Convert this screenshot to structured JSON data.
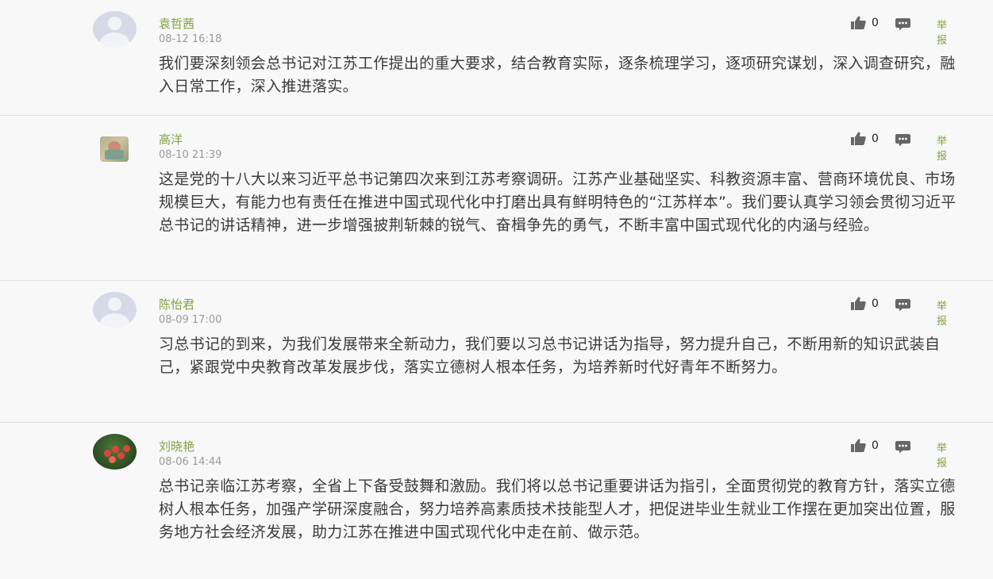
{
  "comments": [
    {
      "name": "袁哲茜",
      "time": "08-12 16:18",
      "text": "我们要深刻领会总书记对江苏工作提出的重大要求，结合教育实际，逐条梳理学习，逐项研究谋划，深入调查研究，融入日常工作，深入推进落实。",
      "likes": "0",
      "report": "举报",
      "avatar": "default-avatar"
    },
    {
      "name": "高洋",
      "time": "08-10 21:39",
      "text": "这是党的十八大以来习近平总书记第四次来到江苏考察调研。江苏产业基础坚实、科教资源丰富、营商环境优良、市场规模巨大，有能力也有责任在推进中国式现代化中打磨出具有鲜明特色的“江苏样本”。我们要认真学习领会贯彻习近平总书记的讲话精神，进一步增强披荆斩棘的锐气、奋楫争先的勇气，不断丰富中国式现代化的内涵与经验。",
      "likes": "0",
      "report": "举报",
      "avatar": "photo-avatar"
    },
    {
      "name": "陈怡君",
      "time": "08-09 17:00",
      "text": "习总书记的到来，为我们发展带来全新动力，我们要以习总书记讲话为指导，努力提升自己，不断用新的知识武装自己，紧跟党中央教育改革发展步伐，落实立德树人根本任务，为培养新时代好青年不断努力。",
      "likes": "0",
      "report": "举报",
      "avatar": "default-avatar"
    },
    {
      "name": "刘晓艳",
      "time": "08-06 14:44",
      "text": "总书记亲临江苏考察，全省上下备受鼓舞和激励。我们将以总书记重要讲话为指引，全面贯彻党的教育方针，落实立德树人根本任务，加强产学研深度融合，努力培养高素质技术技能型人才，把促进毕业生就业工作摆在更加突出位置，服务地方社会经济发展，助力江苏在推进中国式现代化中走在前、做示范。",
      "likes": "0",
      "report": "举报",
      "avatar": "flower-photo-avatar"
    }
  ],
  "colors": {
    "name": "#7fa140",
    "time": "#999999",
    "text": "#3b3b3b",
    "report": "#7fa140"
  },
  "icons": {
    "like": "thumbs-up-icon",
    "reply": "comment-bubble-icon"
  }
}
